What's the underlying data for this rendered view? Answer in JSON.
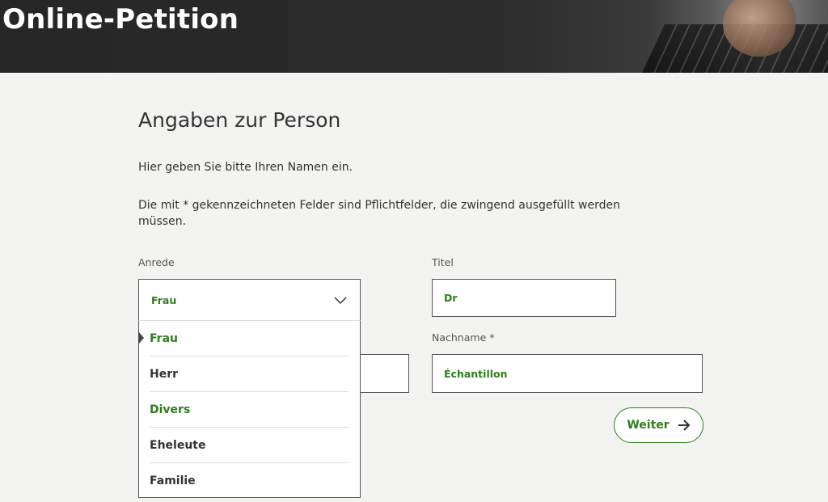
{
  "header": {
    "title": "Online-Petition"
  },
  "page": {
    "heading": "Angaben zur Person",
    "intro": "Hier geben Sie bitte Ihren Namen ein.",
    "required_note": "Die mit * gekennzeichneten Felder sind Pflichtfelder, die zwingend ausgefüllt werden müssen."
  },
  "form": {
    "anrede": {
      "label": "Anrede",
      "selected": "Frau",
      "options": [
        "Frau",
        "Herr",
        "Divers",
        "Eheleute",
        "Familie"
      ]
    },
    "titel": {
      "label": "Titel",
      "value": "Dr"
    },
    "nachname": {
      "label": "Nachname *",
      "value": "Échantillon"
    },
    "vorname": {
      "value": ""
    }
  },
  "actions": {
    "next_label": "Weiter"
  },
  "colors": {
    "accent": "#2e7d1e",
    "banner": "#262626",
    "background": "#f3f3f2"
  }
}
